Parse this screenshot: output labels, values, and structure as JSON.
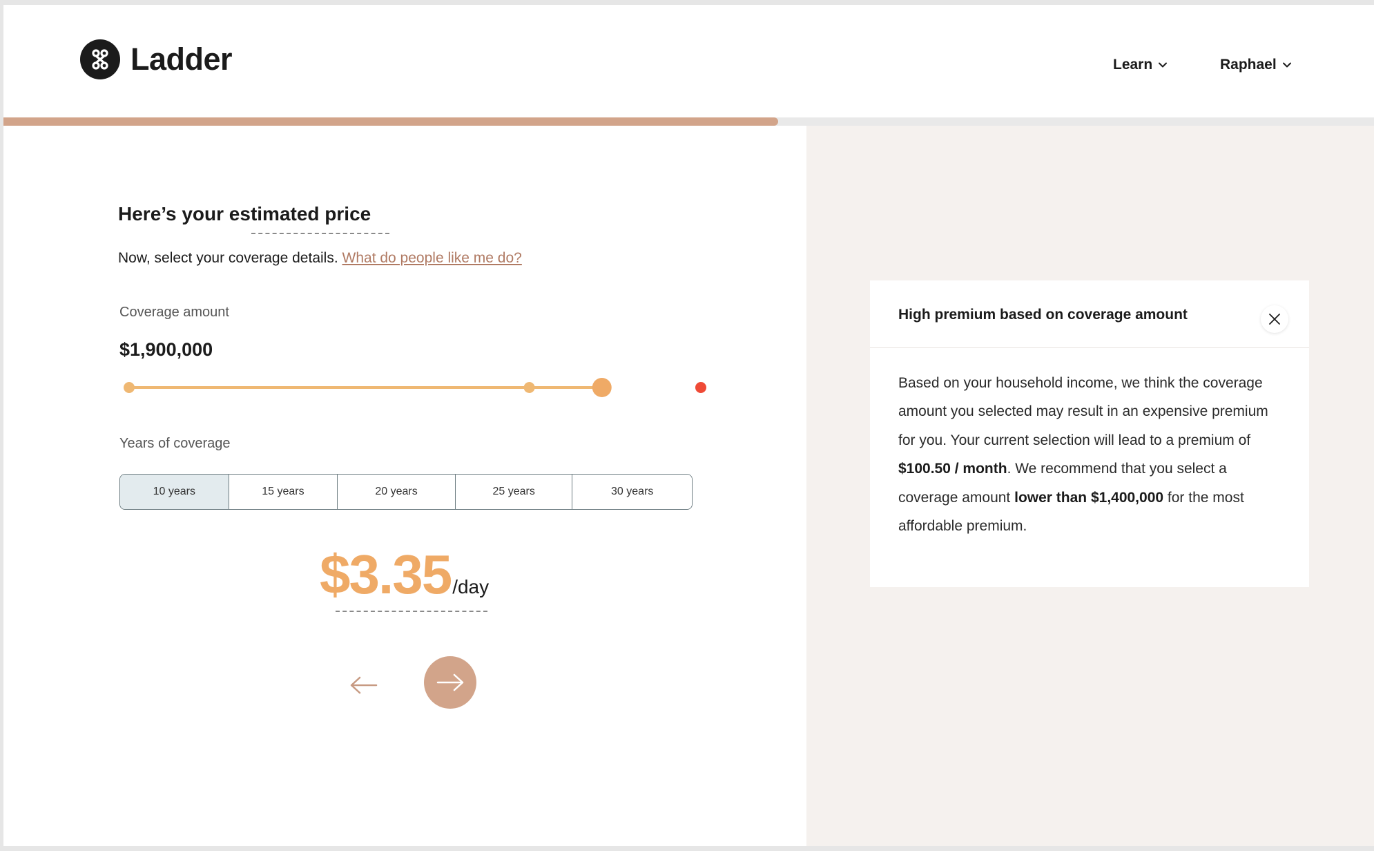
{
  "header": {
    "brand": "Ladder",
    "nav": [
      {
        "label": "Learn"
      },
      {
        "label": "Raphael"
      }
    ]
  },
  "progress": {
    "fraction": 0.565
  },
  "main": {
    "title": "Here’s your estimated price",
    "subtitle": "Now, select your coverage details.",
    "help_link": "What do people like me do?",
    "coverage_label": "Coverage amount",
    "coverage_value": "$1,900,000",
    "coverage_slider": {
      "fraction": 0.827,
      "stops": [
        0,
        0.7,
        0.827,
        1.0
      ],
      "colors": {
        "track": "#efb873",
        "warning": "#ef4a36",
        "knob": "#efaa66"
      }
    },
    "years_label": "Years of coverage",
    "years_options": [
      "10 years",
      "15 years",
      "20 years",
      "25 years",
      "30 years"
    ],
    "years_selected": "10 years",
    "price_amount": "$3.35",
    "price_unit": "/day"
  },
  "alert": {
    "title": "High premium based on coverage amount",
    "body_1": "Based on your household income, we think the coverage amount you selected may result in an expensive premium for you. Your current selection will lead to a premium of ",
    "body_bold_1": "$100.50 / month",
    "body_2": ". We recommend that you select a coverage amount ",
    "body_bold_2": "lower than $1,400,000",
    "body_3": " for the most affordable premium."
  },
  "colors": {
    "accent": "#d2a48a",
    "price": "#efaa66",
    "link": "#b07a63",
    "pane_bg": "#f5f1ee"
  },
  "icons": {
    "logo": "ladder-logo-icon",
    "chevron": "chevron-down-icon",
    "close": "close-icon",
    "back": "arrow-left-icon",
    "next": "arrow-right-icon"
  }
}
